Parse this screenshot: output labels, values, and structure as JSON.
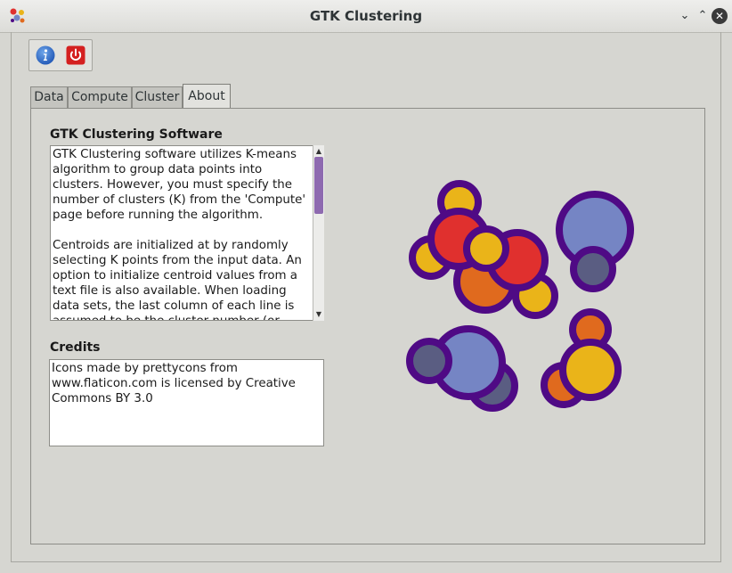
{
  "window": {
    "title": "GTK Clustering"
  },
  "toolbar": {
    "info_icon": "info-icon",
    "power_icon": "power-icon"
  },
  "tabs": [
    {
      "label": "Data"
    },
    {
      "label": "Compute"
    },
    {
      "label": "Cluster"
    },
    {
      "label": "About"
    }
  ],
  "about": {
    "software_title": "GTK Clustering Software",
    "software_p1": "GTK Clustering software utilizes K-means algorithm to group data points into clusters. However, you must specify the number of clusters (K) from the 'Compute' page before running the algorithm.",
    "software_p2": "Centroids are initialized at by randomly selecting K points from the input data. An option to initialize centroid values from a text file is also available. When loading data sets, the last column of each line is assumed to be the cluster number (or",
    "credits_title": "Credits",
    "credits_text": "Icons made by prettycons from www.flaticon.com is licensed by Creative Commons BY 3.0"
  },
  "colors": {
    "ring": "#4f0a85",
    "yellow": "#eab419",
    "red": "#e0302e",
    "orange": "#e06a1e",
    "blue": "#7585c4",
    "slate": "#5a5d82"
  }
}
